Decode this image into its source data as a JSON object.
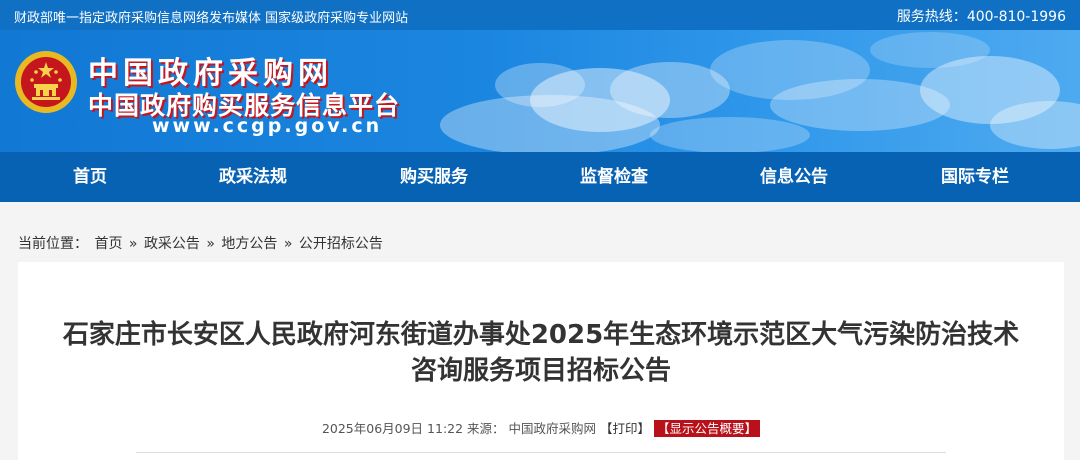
{
  "topbar": {
    "left_text": "财政部唯一指定政府采购信息网络发布媒体 国家级政府采购专业网站",
    "hotline_label": "服务热线：",
    "hotline_number": "400-810-1996"
  },
  "banner": {
    "site_name": "中国政府采购网",
    "site_subtitle": "中国政府购买服务信息平台",
    "site_url": "www.ccgp.gov.cn"
  },
  "nav": {
    "items": [
      "首页",
      "政采法规",
      "购买服务",
      "监督检查",
      "信息公告",
      "国际专栏"
    ]
  },
  "breadcrumb": {
    "label": "当前位置：",
    "items": [
      "首页",
      "政采公告",
      "地方公告",
      "公开招标公告"
    ],
    "separator": "»"
  },
  "article": {
    "title_line1": "石家庄市长安区人民政府河东街道办事处2025年生态环境示范区大气污染防治技术",
    "title_line2": "咨询服务项目招标公告",
    "date": "2025年06月09日 11:22",
    "source_label": "来源：",
    "source": "中国政府采购网",
    "print_label": "【打印】",
    "summary_label": "【显示公告概要】"
  },
  "colors": {
    "topbar": "#0f70c4",
    "nav": "#0862b4",
    "accent_red": "#b8111a",
    "page_bg": "#f4f4f4"
  }
}
